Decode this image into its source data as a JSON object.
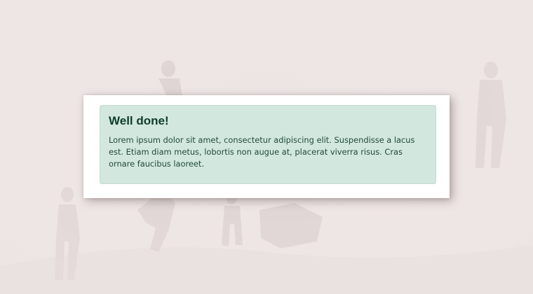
{
  "alert": {
    "heading": "Well done!",
    "body": "Lorem ipsum dolor sit amet, consectetur adipiscing elit. Suspendisse a lacus est. Etiam diam metus, lobortis non augue at, placerat viverra risus. Cras ornare faucibus laoreet."
  },
  "colors": {
    "page_background": "#ede5e4",
    "card_background": "#ffffff",
    "alert_background": "#d2e7de",
    "alert_heading": "#0f3d2c",
    "alert_text": "#244a3c"
  },
  "icons": {
    "background_decoration": "hikers-silhouette-icon"
  }
}
